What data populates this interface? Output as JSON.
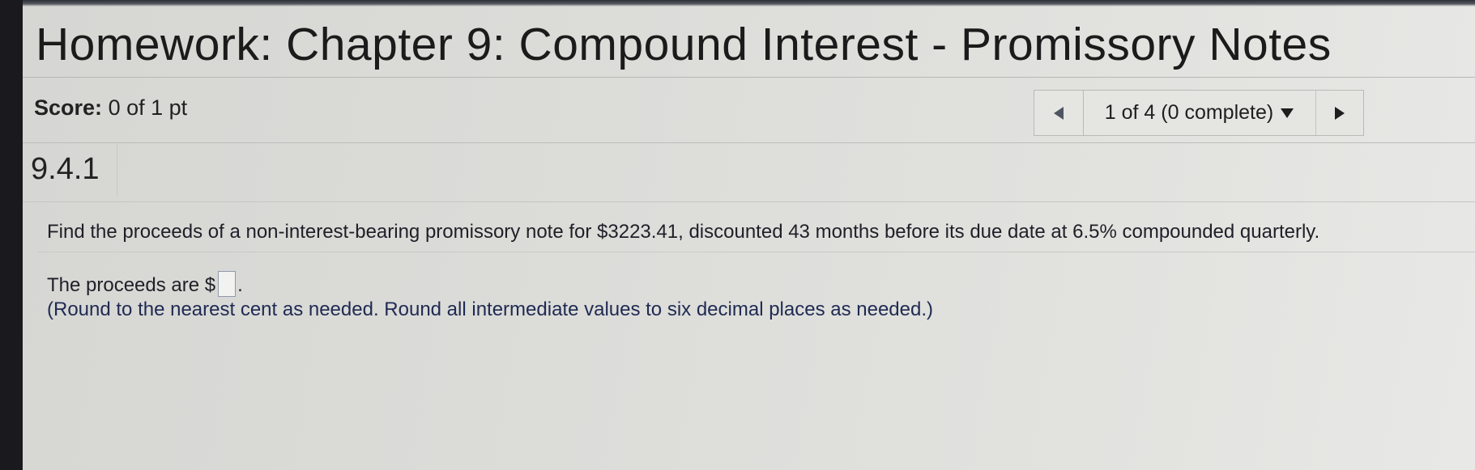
{
  "header": {
    "title": "Homework: Chapter 9: Compound Interest - Promissory Notes"
  },
  "score": {
    "label": "Score:",
    "value": "0 of 1 pt"
  },
  "navigator": {
    "prev_icon": "triangle-left-icon",
    "position_text": "1 of 4 (0 complete)",
    "dropdown_icon": "triangle-down-icon",
    "next_icon": "triangle-right-icon"
  },
  "question": {
    "number": "9.4.1",
    "prompt": "Find the proceeds of a non-interest-bearing promissory note for $3223.41, discounted 43 months before its due date at 6.5% compounded quarterly.",
    "answer_prefix": "The proceeds are $",
    "answer_value": "",
    "answer_suffix": ".",
    "instructions": "(Round to the nearest cent as needed. Round all intermediate values to six decimal places as needed.)"
  },
  "colors": {
    "background": "#dcdcd9",
    "text": "#1f1f28",
    "instruction_text": "#1f2a52",
    "bezel": "#1a1a1e"
  }
}
